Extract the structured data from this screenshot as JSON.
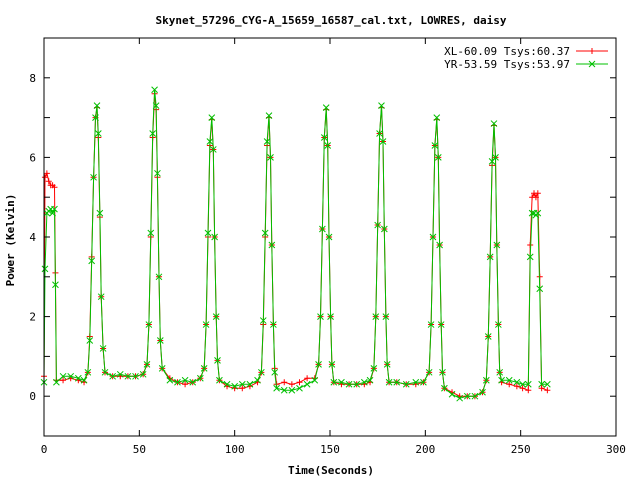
{
  "chart_data": {
    "type": "line",
    "title": "Skynet_57296_CYG-A_15659_16587_cal.txt, LOWRES, daisy",
    "xlabel": "Time(Seconds)",
    "ylabel": "Power (Kelvin)",
    "xlim": [
      0,
      300
    ],
    "ylim": [
      -1,
      9
    ],
    "xticks": [
      "0",
      "50",
      "100",
      "150",
      "200",
      "250",
      "300"
    ],
    "yticks": [
      "0",
      "2",
      "4",
      "6",
      "8"
    ],
    "grid": false,
    "legend_position": "top-right",
    "series": [
      {
        "name": "XL-60.09 Tsys:60.37",
        "color": "#ff0000",
        "marker": "plus",
        "points": [
          [
            0,
            0.5
          ],
          [
            0.5,
            5.5
          ],
          [
            1.5,
            5.6
          ],
          [
            2.5,
            5.4
          ],
          [
            3.5,
            5.3
          ],
          [
            4.5,
            5.3
          ],
          [
            5.5,
            5.25
          ],
          [
            6,
            3.1
          ],
          [
            6.5,
            0.4
          ],
          [
            10,
            0.4
          ],
          [
            14,
            0.45
          ],
          [
            18,
            0.4
          ],
          [
            21,
            0.35
          ],
          [
            23,
            0.6
          ],
          [
            24,
            1.5
          ],
          [
            25,
            3.5
          ],
          [
            26,
            5.5
          ],
          [
            27,
            7.0
          ],
          [
            27.8,
            7.25
          ],
          [
            28.5,
            6.5
          ],
          [
            29.3,
            4.5
          ],
          [
            30,
            2.5
          ],
          [
            31,
            1.2
          ],
          [
            32,
            0.6
          ],
          [
            36,
            0.5
          ],
          [
            40,
            0.5
          ],
          [
            44,
            0.5
          ],
          [
            48,
            0.5
          ],
          [
            52,
            0.55
          ],
          [
            54,
            0.8
          ],
          [
            55,
            1.8
          ],
          [
            56,
            4.0
          ],
          [
            57,
            6.5
          ],
          [
            58,
            7.6
          ],
          [
            58.8,
            7.2
          ],
          [
            59.5,
            5.5
          ],
          [
            60.3,
            3.0
          ],
          [
            61,
            1.4
          ],
          [
            62,
            0.7
          ],
          [
            66,
            0.45
          ],
          [
            70,
            0.35
          ],
          [
            74,
            0.3
          ],
          [
            78,
            0.35
          ],
          [
            82,
            0.45
          ],
          [
            84,
            0.7
          ],
          [
            85,
            1.8
          ],
          [
            86,
            4.0
          ],
          [
            87,
            6.3
          ],
          [
            88,
            6.95
          ],
          [
            88.8,
            6.2
          ],
          [
            89.5,
            4.0
          ],
          [
            90.3,
            2.0
          ],
          [
            91,
            0.9
          ],
          [
            92,
            0.4
          ],
          [
            96,
            0.25
          ],
          [
            100,
            0.2
          ],
          [
            104,
            0.2
          ],
          [
            108,
            0.25
          ],
          [
            112,
            0.35
          ],
          [
            114,
            0.6
          ],
          [
            115,
            1.8
          ],
          [
            116,
            4.0
          ],
          [
            117,
            6.3
          ],
          [
            118,
            7.0
          ],
          [
            118.8,
            6.0
          ],
          [
            119.5,
            3.8
          ],
          [
            120.3,
            1.8
          ],
          [
            121,
            0.7
          ],
          [
            122,
            0.3
          ],
          [
            126,
            0.35
          ],
          [
            130,
            0.3
          ],
          [
            134,
            0.35
          ],
          [
            138,
            0.45
          ],
          [
            142,
            0.45
          ],
          [
            144,
            0.8
          ],
          [
            145,
            2.0
          ],
          [
            146,
            4.2
          ],
          [
            147,
            6.5
          ],
          [
            148,
            7.2
          ],
          [
            148.8,
            6.3
          ],
          [
            149.5,
            4.0
          ],
          [
            150.3,
            2.0
          ],
          [
            151,
            0.8
          ],
          [
            152,
            0.35
          ],
          [
            156,
            0.3
          ],
          [
            160,
            0.3
          ],
          [
            164,
            0.3
          ],
          [
            168,
            0.3
          ],
          [
            171,
            0.35
          ],
          [
            173,
            0.7
          ],
          [
            174,
            2.0
          ],
          [
            175,
            4.3
          ],
          [
            176,
            6.6
          ],
          [
            177,
            7.25
          ],
          [
            177.8,
            6.4
          ],
          [
            178.5,
            4.2
          ],
          [
            179.3,
            2.0
          ],
          [
            180,
            0.8
          ],
          [
            181,
            0.35
          ],
          [
            185,
            0.35
          ],
          [
            190,
            0.3
          ],
          [
            195,
            0.3
          ],
          [
            199,
            0.35
          ],
          [
            202,
            0.6
          ],
          [
            203,
            1.8
          ],
          [
            204,
            4.0
          ],
          [
            205,
            6.3
          ],
          [
            206,
            6.95
          ],
          [
            206.8,
            6.0
          ],
          [
            207.5,
            3.8
          ],
          [
            208.3,
            1.8
          ],
          [
            209,
            0.6
          ],
          [
            210,
            0.2
          ],
          [
            214,
            0.1
          ],
          [
            218,
            0.0
          ],
          [
            222,
            0.0
          ],
          [
            226,
            0.0
          ],
          [
            230,
            0.1
          ],
          [
            232,
            0.4
          ],
          [
            233,
            1.5
          ],
          [
            234,
            3.5
          ],
          [
            235,
            5.8
          ],
          [
            236,
            6.8
          ],
          [
            236.8,
            6.0
          ],
          [
            237.5,
            3.8
          ],
          [
            238.3,
            1.8
          ],
          [
            239,
            0.6
          ],
          [
            240,
            0.35
          ],
          [
            244,
            0.3
          ],
          [
            248,
            0.25
          ],
          [
            251,
            0.2
          ],
          [
            254,
            0.15
          ],
          [
            255,
            3.8
          ],
          [
            256,
            5.0
          ],
          [
            257,
            5.1
          ],
          [
            258,
            5.0
          ],
          [
            259,
            5.1
          ],
          [
            260,
            3.0
          ],
          [
            261,
            0.2
          ],
          [
            264,
            0.15
          ]
        ]
      },
      {
        "name": "YR-53.59 Tsys:53.97",
        "color": "#00c000",
        "marker": "cross",
        "points": [
          [
            0,
            0.35
          ],
          [
            0.5,
            3.2
          ],
          [
            1.5,
            4.6
          ],
          [
            2.5,
            4.65
          ],
          [
            3.5,
            4.7
          ],
          [
            4.5,
            4.6
          ],
          [
            5.5,
            4.7
          ],
          [
            6,
            2.8
          ],
          [
            6.5,
            0.35
          ],
          [
            10,
            0.5
          ],
          [
            14,
            0.5
          ],
          [
            18,
            0.45
          ],
          [
            21,
            0.4
          ],
          [
            23,
            0.6
          ],
          [
            24,
            1.4
          ],
          [
            25,
            3.4
          ],
          [
            26,
            5.5
          ],
          [
            27,
            7.0
          ],
          [
            27.8,
            7.3
          ],
          [
            28.5,
            6.6
          ],
          [
            29.3,
            4.6
          ],
          [
            30,
            2.5
          ],
          [
            31,
            1.2
          ],
          [
            32,
            0.6
          ],
          [
            36,
            0.5
          ],
          [
            40,
            0.55
          ],
          [
            44,
            0.5
          ],
          [
            48,
            0.5
          ],
          [
            52,
            0.55
          ],
          [
            54,
            0.8
          ],
          [
            55,
            1.8
          ],
          [
            56,
            4.1
          ],
          [
            57,
            6.6
          ],
          [
            58,
            7.7
          ],
          [
            58.8,
            7.3
          ],
          [
            59.5,
            5.6
          ],
          [
            60.3,
            3.0
          ],
          [
            61,
            1.4
          ],
          [
            62,
            0.7
          ],
          [
            66,
            0.4
          ],
          [
            70,
            0.35
          ],
          [
            74,
            0.4
          ],
          [
            78,
            0.35
          ],
          [
            82,
            0.45
          ],
          [
            84,
            0.7
          ],
          [
            85,
            1.8
          ],
          [
            86,
            4.1
          ],
          [
            87,
            6.4
          ],
          [
            88,
            7.0
          ],
          [
            88.8,
            6.2
          ],
          [
            89.5,
            4.0
          ],
          [
            90.3,
            2.0
          ],
          [
            91,
            0.9
          ],
          [
            92,
            0.4
          ],
          [
            96,
            0.3
          ],
          [
            100,
            0.25
          ],
          [
            104,
            0.3
          ],
          [
            108,
            0.3
          ],
          [
            112,
            0.4
          ],
          [
            114,
            0.6
          ],
          [
            115,
            1.9
          ],
          [
            116,
            4.1
          ],
          [
            117,
            6.4
          ],
          [
            118,
            7.05
          ],
          [
            118.8,
            6.0
          ],
          [
            119.5,
            3.8
          ],
          [
            120.3,
            1.8
          ],
          [
            121,
            0.6
          ],
          [
            122,
            0.2
          ],
          [
            126,
            0.15
          ],
          [
            130,
            0.15
          ],
          [
            134,
            0.2
          ],
          [
            138,
            0.3
          ],
          [
            142,
            0.4
          ],
          [
            144,
            0.8
          ],
          [
            145,
            2.0
          ],
          [
            146,
            4.2
          ],
          [
            147,
            6.5
          ],
          [
            148,
            7.25
          ],
          [
            148.8,
            6.3
          ],
          [
            149.5,
            4.0
          ],
          [
            150.3,
            2.0
          ],
          [
            151,
            0.8
          ],
          [
            152,
            0.35
          ],
          [
            156,
            0.35
          ],
          [
            160,
            0.3
          ],
          [
            164,
            0.3
          ],
          [
            168,
            0.35
          ],
          [
            171,
            0.4
          ],
          [
            173,
            0.7
          ],
          [
            174,
            2.0
          ],
          [
            175,
            4.3
          ],
          [
            176,
            6.6
          ],
          [
            177,
            7.3
          ],
          [
            177.8,
            6.4
          ],
          [
            178.5,
            4.2
          ],
          [
            179.3,
            2.0
          ],
          [
            180,
            0.8
          ],
          [
            181,
            0.35
          ],
          [
            185,
            0.35
          ],
          [
            190,
            0.3
          ],
          [
            195,
            0.35
          ],
          [
            199,
            0.35
          ],
          [
            202,
            0.6
          ],
          [
            203,
            1.8
          ],
          [
            204,
            4.0
          ],
          [
            205,
            6.3
          ],
          [
            206,
            7.0
          ],
          [
            206.8,
            6.0
          ],
          [
            207.5,
            3.8
          ],
          [
            208.3,
            1.8
          ],
          [
            209,
            0.6
          ],
          [
            210,
            0.2
          ],
          [
            214,
            0.05
          ],
          [
            218,
            -0.05
          ],
          [
            222,
            0.0
          ],
          [
            226,
            0.0
          ],
          [
            230,
            0.1
          ],
          [
            232,
            0.4
          ],
          [
            233,
            1.5
          ],
          [
            234,
            3.5
          ],
          [
            235,
            5.9
          ],
          [
            236,
            6.85
          ],
          [
            236.8,
            6.0
          ],
          [
            237.5,
            3.8
          ],
          [
            238.3,
            1.8
          ],
          [
            239,
            0.6
          ],
          [
            240,
            0.4
          ],
          [
            244,
            0.4
          ],
          [
            248,
            0.35
          ],
          [
            251,
            0.3
          ],
          [
            254,
            0.3
          ],
          [
            255,
            3.5
          ],
          [
            256,
            4.6
          ],
          [
            257,
            4.6
          ],
          [
            258,
            4.55
          ],
          [
            259,
            4.6
          ],
          [
            260,
            2.7
          ],
          [
            261,
            0.3
          ],
          [
            264,
            0.3
          ]
        ]
      }
    ]
  }
}
